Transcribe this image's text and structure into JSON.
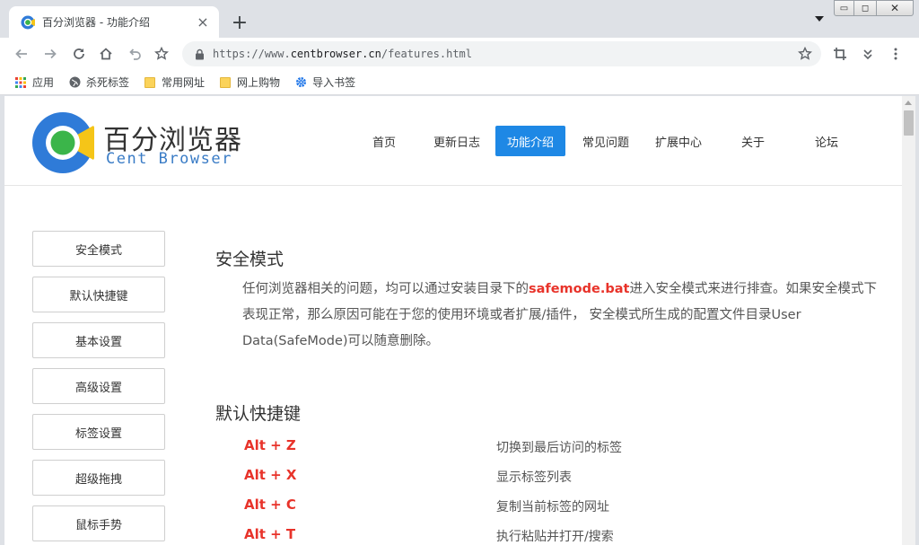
{
  "browser": {
    "tab_title": "百分浏览器 - 功能介绍",
    "tab_close": "×",
    "new_tab": "+",
    "url_scheme": "https://www.",
    "url_host": "centbrowser.cn",
    "url_path": "/features.html",
    "window_controls": {
      "minimize": "▭",
      "maximize": "◻",
      "close": "✕"
    }
  },
  "bookmarks": [
    {
      "label": "应用",
      "icon": "apps-grid-icon"
    },
    {
      "label": "杀死标签",
      "icon": "globe-icon"
    },
    {
      "label": "常用网址",
      "icon": "folder-icon"
    },
    {
      "label": "网上购物",
      "icon": "folder-icon"
    },
    {
      "label": "导入书签",
      "icon": "gear-icon"
    }
  ],
  "site": {
    "brand_cn": "百分浏览器",
    "brand_en": "Cent Browser",
    "nav": [
      "首页",
      "更新日志",
      "功能介绍",
      "常见问题",
      "扩展中心",
      "关于",
      "论坛"
    ],
    "nav_active": "功能介绍"
  },
  "sidebar": [
    "安全模式",
    "默认快捷键",
    "基本设置",
    "高级设置",
    "标签设置",
    "超级拖拽",
    "鼠标手势"
  ],
  "content": {
    "safe_mode": {
      "title": "安全模式",
      "text_before": "任何浏览器相关的问题，均可以通过安装目录下的",
      "highlight": "safemode.bat",
      "text_after": "进入安全模式来进行排查。如果安全模式下表现正常，那么原因可能在于您的使用环境或者扩展/插件， 安全模式所生成的配置文件目录User Data(SafeMode)可以随意删除。"
    },
    "shortcuts": {
      "title": "默认快捷键",
      "rows": [
        {
          "key": "Alt + Z",
          "desc": "切换到最后访问的标签"
        },
        {
          "key": "Alt + X",
          "desc": "显示标签列表"
        },
        {
          "key": "Alt + C",
          "desc": "复制当前标签的网址"
        },
        {
          "key": "Alt + T",
          "desc": "执行粘贴并打开/搜索"
        }
      ]
    }
  },
  "colors": {
    "accent": "#1e88e5",
    "highlight": "#e8332a",
    "brand_en": "#3a7cc6"
  }
}
